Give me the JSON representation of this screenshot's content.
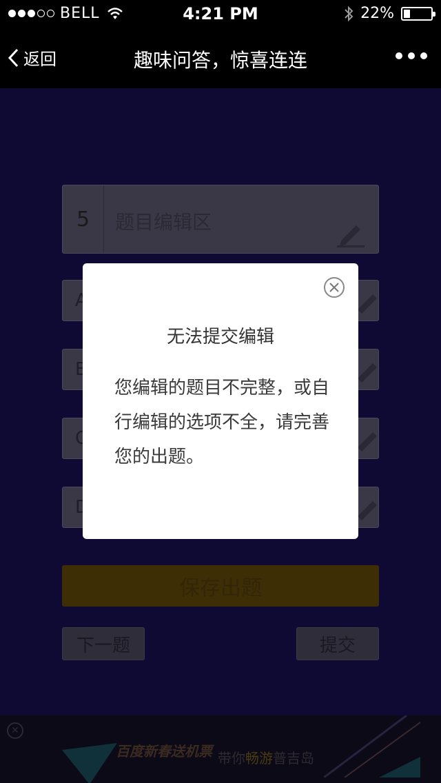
{
  "status": {
    "carrier": "BELL",
    "time": "4:21 PM",
    "battery": "22%",
    "battery_level": 0.22
  },
  "nav": {
    "back_label": "返回",
    "title": "趣味问答，惊喜连连"
  },
  "editor": {
    "question_number": "5",
    "question_placeholder": "题目编辑区",
    "options": [
      "A",
      "B",
      "C",
      "D"
    ],
    "save_label": "保存出题",
    "next_label": "下一题",
    "submit_label": "提交"
  },
  "dialog": {
    "title": "无法提交编辑",
    "message": "您编辑的题目不完整，或自行编辑的选项不全，请完善您的出题。"
  },
  "ad": {
    "text1": "百度新春送机票",
    "text2_prefix": "带你",
    "text2_highlight": "畅游",
    "text2_suffix": "普吉岛"
  },
  "colors": {
    "main_bg": "#0f0a33",
    "save_button": "#3e2e06",
    "dialog_bg": "#ffffff"
  }
}
